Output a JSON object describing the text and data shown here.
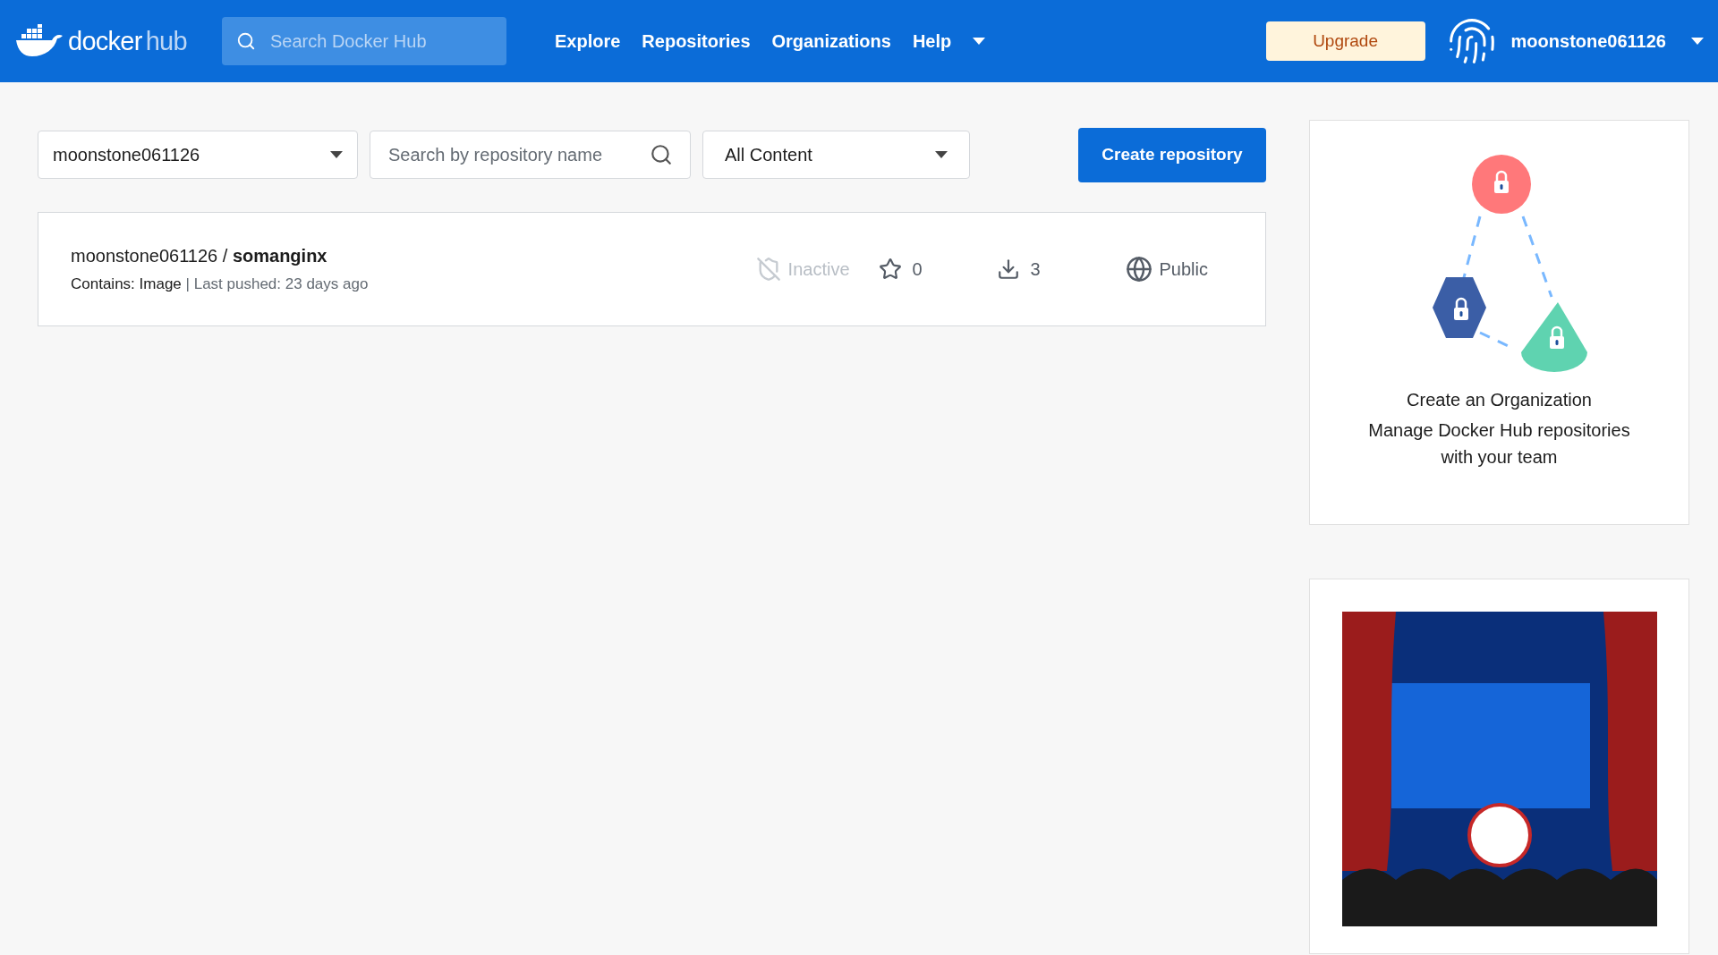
{
  "header": {
    "logo": {
      "brand": "docker",
      "product": "hub"
    },
    "search": {
      "placeholder": "Search Docker Hub"
    },
    "nav": [
      {
        "label": "Explore"
      },
      {
        "label": "Repositories"
      },
      {
        "label": "Organizations"
      },
      {
        "label": "Help"
      }
    ],
    "upgrade": "Upgrade",
    "username": "moonstone061126"
  },
  "filters": {
    "namespace": "moonstone061126",
    "search": {
      "placeholder": "Search by repository name"
    },
    "content": "All Content"
  },
  "create_button": "Create repository",
  "repositories": [
    {
      "namespace": "moonstone061126",
      "separator": "/",
      "name": "somanginx",
      "contains": "Contains: Image",
      "pushed": "| Last pushed: 23 days ago",
      "status": "Inactive",
      "stars": "0",
      "pulls": "3",
      "visibility": "Public"
    }
  ],
  "org_card": {
    "title": "Create an Organization",
    "text": "Manage Docker Hub repositories with your team"
  }
}
